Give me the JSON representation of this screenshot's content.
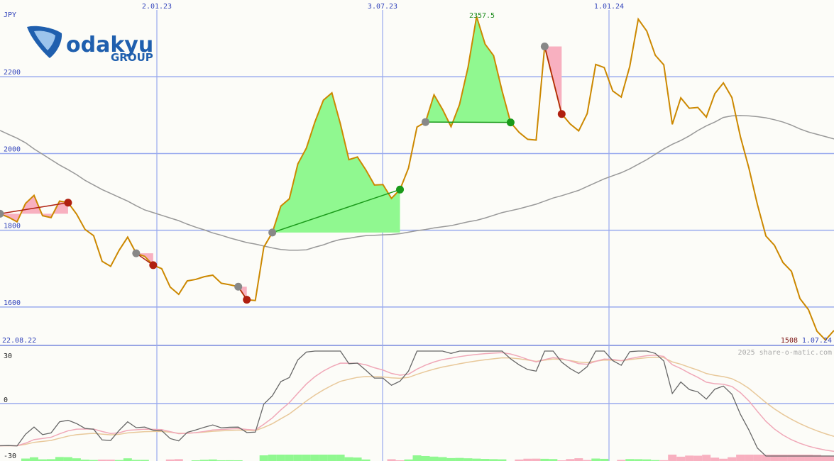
{
  "chart_data": {
    "type": "line",
    "currency": "JPY",
    "date_start": "22.08.22",
    "date_end": "1.07.24",
    "x_tick_labels": [
      "2.01.23",
      "3.07.23",
      "1.01.24"
    ],
    "price_panel": {
      "ylim": [
        1500,
        2400
      ],
      "y_ticks": [
        1600,
        1800,
        2000,
        2200
      ],
      "y_tick_labels": [
        "1600",
        "1800",
        "2000",
        "2200"
      ],
      "price": [
        1843,
        1834,
        1822,
        1870,
        1891,
        1838,
        1833,
        1876,
        1872,
        1842,
        1802,
        1786,
        1719,
        1706,
        1748,
        1782,
        1740,
        1732,
        1709,
        1700,
        1652,
        1633,
        1668,
        1672,
        1679,
        1683,
        1662,
        1658,
        1653,
        1619,
        1617,
        1756,
        1794,
        1863,
        1882,
        1973,
        2014,
        2082,
        2139,
        2158,
        2077,
        1984,
        1991,
        1957,
        1918,
        1919,
        1883,
        1906,
        1962,
        2069,
        2082,
        2153,
        2115,
        2070,
        2128,
        2225,
        2357,
        2285,
        2255,
        2163,
        2081,
        2055,
        2037,
        2035,
        2279,
        2191,
        2103,
        2077,
        2059,
        2104,
        2232,
        2224,
        2163,
        2147,
        2227,
        2350,
        2319,
        2256,
        2231,
        2076,
        2145,
        2118,
        2120,
        2095,
        2156,
        2184,
        2146,
        2044,
        1962,
        1867,
        1785,
        1761,
        1716,
        1693,
        1622,
        1593,
        1537,
        1514,
        1539
      ],
      "moving_average": [
        2060,
        2050,
        2040,
        2028,
        2012,
        1998,
        1984,
        1970,
        1958,
        1945,
        1930,
        1918,
        1906,
        1896,
        1886,
        1876,
        1864,
        1853,
        1846,
        1839,
        1832,
        1825,
        1816,
        1808,
        1801,
        1793,
        1787,
        1780,
        1774,
        1768,
        1764,
        1759,
        1754,
        1750,
        1748,
        1748,
        1749,
        1756,
        1762,
        1770,
        1776,
        1779,
        1783,
        1786,
        1787,
        1788,
        1789,
        1791,
        1795,
        1799,
        1802,
        1806,
        1809,
        1812,
        1817,
        1822,
        1826,
        1832,
        1839,
        1846,
        1851,
        1856,
        1862,
        1868,
        1876,
        1884,
        1890,
        1897,
        1904,
        1914,
        1924,
        1934,
        1942,
        1950,
        1960,
        1972,
        1984,
        1998,
        2012,
        2024,
        2034,
        2046,
        2060,
        2072,
        2082,
        2094,
        2098,
        2099,
        2098,
        2096,
        2093,
        2088,
        2082,
        2074,
        2064,
        2056,
        2050,
        2044,
        2038
      ],
      "peak_label": "2357.5",
      "low_label": "1508",
      "trades": [
        {
          "entry_index": 0,
          "exit_index": 8,
          "result": "loss"
        },
        {
          "entry_index": 16,
          "exit_index": 18,
          "result": "loss"
        },
        {
          "entry_index": 28,
          "exit_index": 29,
          "result": "loss"
        },
        {
          "entry_index": 32,
          "exit_index": 47,
          "result": "gain"
        },
        {
          "entry_index": 50,
          "exit_index": 60,
          "result": "gain"
        },
        {
          "entry_index": 64,
          "exit_index": 66,
          "result": "loss"
        }
      ]
    },
    "indicator_panel": {
      "ylim": [
        -30,
        30
      ],
      "y_ticks": [
        -30,
        0,
        30
      ],
      "y_tick_labels": [
        "-30",
        "0",
        "30"
      ]
    }
  },
  "colors": {
    "price_line": "#cc8800",
    "moving_average": "#999999",
    "gain_fill": "#90f890",
    "loss_fill": "#f8b0c0",
    "entry_dot": "#888888",
    "gain_dot": "#1a9a1a",
    "loss_dot": "#b02010",
    "grid": "#99aaee",
    "logo": "#1f5fae"
  },
  "logo": {
    "brand": "odakyu",
    "group": "GROUP"
  },
  "watermark": "2025 share-o-matic.com"
}
